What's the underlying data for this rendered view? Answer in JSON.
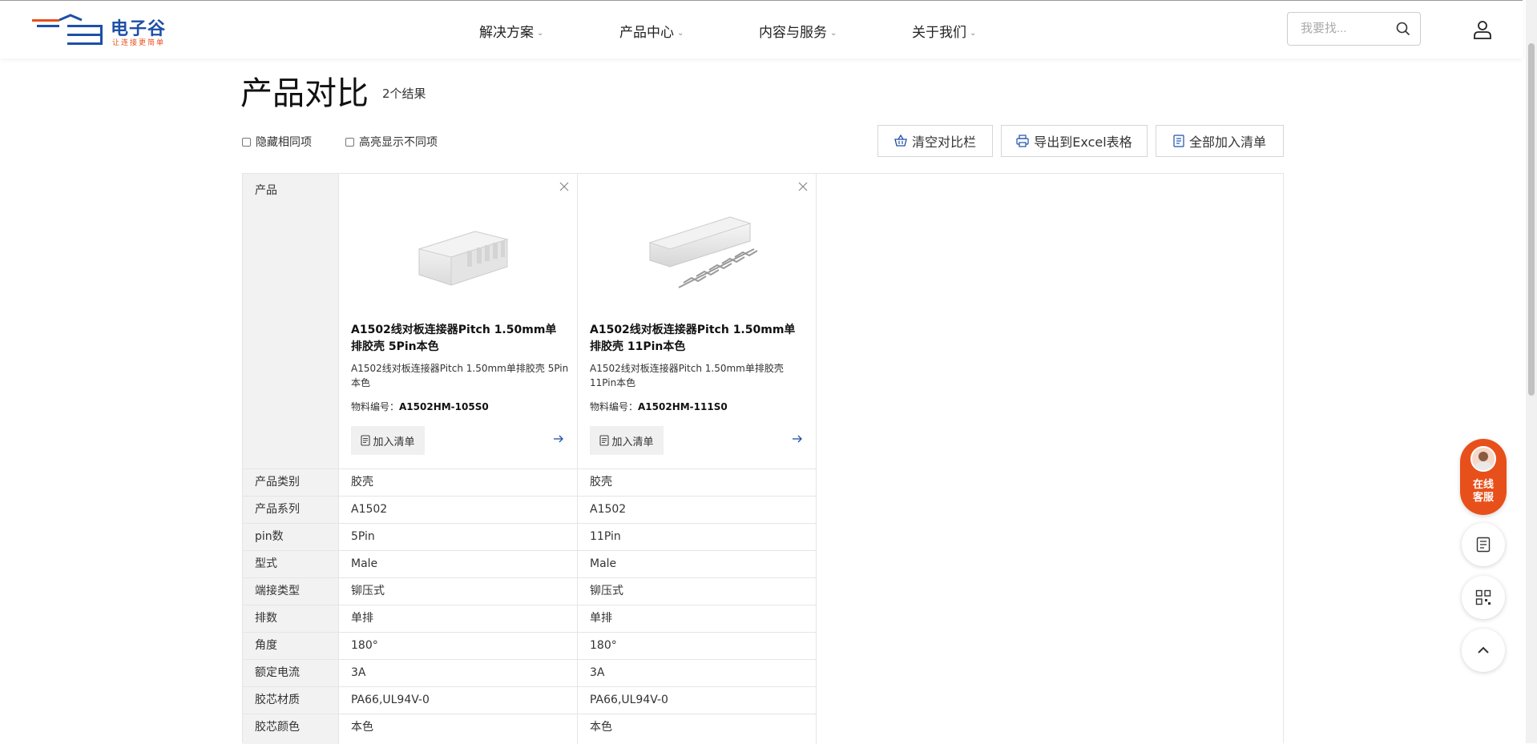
{
  "brand": {
    "logo_text": "电子谷",
    "slogan": "让连接更简单",
    "colors": {
      "primary": "#1e4fa8",
      "accent": "#e8501b"
    }
  },
  "nav": {
    "items": [
      {
        "label": "解决方案"
      },
      {
        "label": "产品中心"
      },
      {
        "label": "内容与服务"
      },
      {
        "label": "关于我们"
      }
    ],
    "search_placeholder": "我要找..."
  },
  "page": {
    "title": "产品对比",
    "result_count": "2个结果"
  },
  "options": {
    "hide_same": "隐藏相同项",
    "highlight_diff": "高亮显示不同项"
  },
  "actions": {
    "clear": "清空对比栏",
    "export": "导出到Excel表格",
    "add_all": "全部加入清单"
  },
  "table": {
    "product_label": "产品",
    "products": [
      {
        "name": "A1502线对板连接器Pitch 1.50mm单排胶壳 5Pin本色",
        "desc": "A1502线对板连接器Pitch 1.50mm单排胶壳 5Pin本色",
        "code_label": "物料编号：",
        "code": "A1502HM-105S0",
        "add_label": "加入清单"
      },
      {
        "name": "A1502线对板连接器Pitch 1.50mm单排胶壳 11Pin本色",
        "desc": "A1502线对板连接器Pitch 1.50mm单排胶壳 11Pin本色",
        "code_label": "物料编号：",
        "code": "A1502HM-111S0",
        "add_label": "加入清单"
      }
    ],
    "rows": [
      {
        "label": "产品类别",
        "values": [
          "胶壳",
          "胶壳"
        ]
      },
      {
        "label": "产品系列",
        "values": [
          "A1502",
          "A1502"
        ]
      },
      {
        "label": "pin数",
        "values": [
          "5Pin",
          "11Pin"
        ]
      },
      {
        "label": "型式",
        "values": [
          "Male",
          "Male"
        ]
      },
      {
        "label": "端接类型",
        "values": [
          "铆压式",
          "铆压式"
        ]
      },
      {
        "label": "排数",
        "values": [
          "单排",
          "单排"
        ]
      },
      {
        "label": "角度",
        "values": [
          "180°",
          "180°"
        ]
      },
      {
        "label": "额定电流",
        "values": [
          "3A",
          "3A"
        ]
      },
      {
        "label": "胶芯材质",
        "values": [
          "PA66,UL94V-0",
          "PA66,UL94V-0"
        ]
      },
      {
        "label": "胶芯颜色",
        "values": [
          "本色",
          "本色"
        ]
      }
    ]
  },
  "float": {
    "service_line1": "在线",
    "service_line2": "客服",
    "icons": [
      "list-icon",
      "qrcode-icon",
      "chevron-up-icon"
    ]
  }
}
